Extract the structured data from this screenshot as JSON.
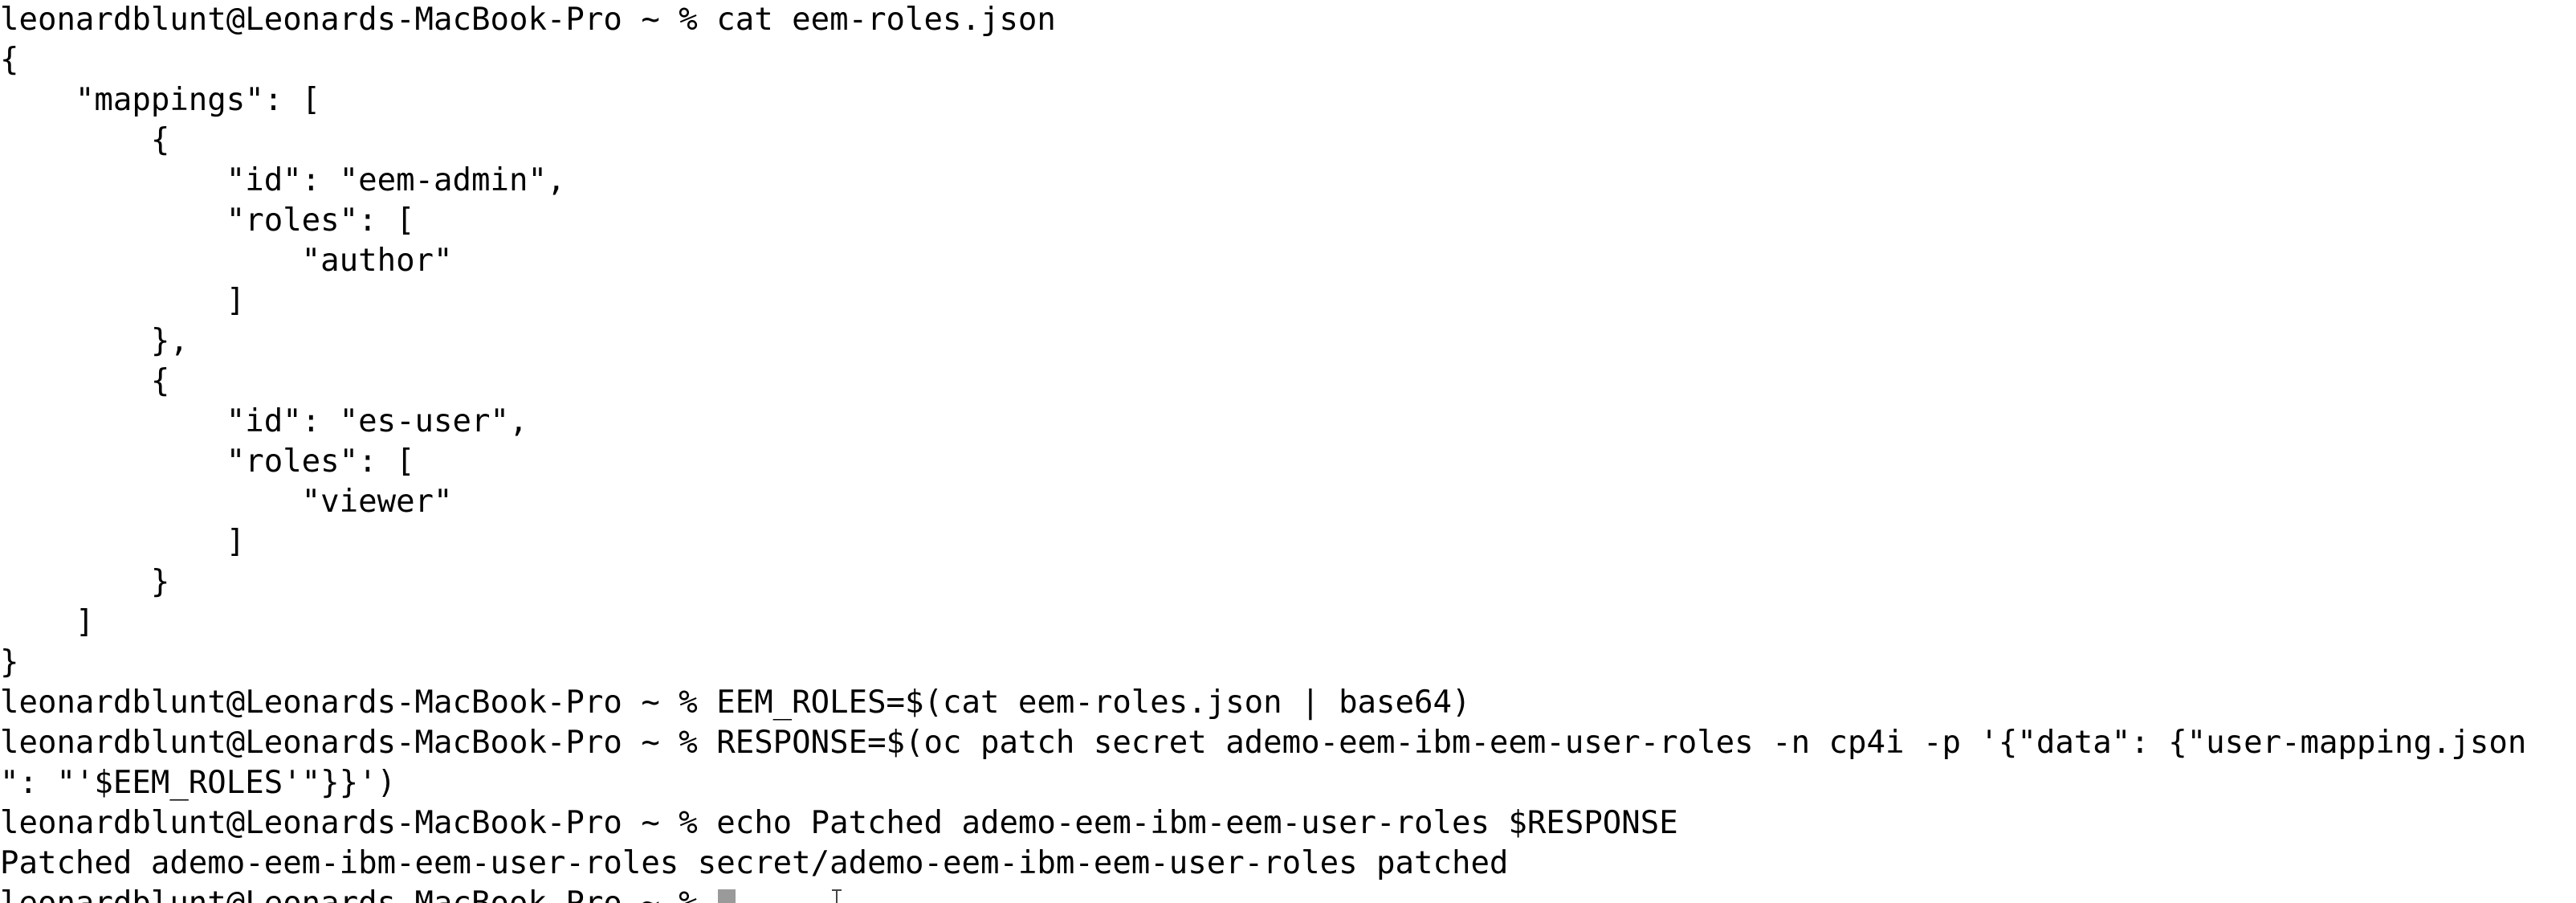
{
  "terminal": {
    "prompt": "leonardblunt@Leonards-MacBook-Pro ~ % ",
    "lines": [
      "leonardblunt@Leonards-MacBook-Pro ~ % cat eem-roles.json",
      "{",
      "    \"mappings\": [",
      "        {",
      "            \"id\": \"eem-admin\",",
      "            \"roles\": [",
      "                \"author\"",
      "            ]",
      "        },",
      "        {",
      "            \"id\": \"es-user\",",
      "            \"roles\": [",
      "                \"viewer\"",
      "            ]",
      "        }",
      "    ]",
      "}",
      "leonardblunt@Leonards-MacBook-Pro ~ % EEM_ROLES=$(cat eem-roles.json | base64)",
      "leonardblunt@Leonards-MacBook-Pro ~ % RESPONSE=$(oc patch secret ademo-eem-ibm-eem-user-roles -n cp4i -p '{\"data\": {\"user-mapping.json",
      "\": \"'$EEM_ROLES'\"}}')",
      "leonardblunt@Leonards-MacBook-Pro ~ % echo Patched ademo-eem-ibm-eem-user-roles $RESPONSE",
      "Patched ademo-eem-ibm-eem-user-roles secret/ademo-eem-ibm-eem-user-roles patched"
    ],
    "cursor_color": "#9a9a9a"
  }
}
